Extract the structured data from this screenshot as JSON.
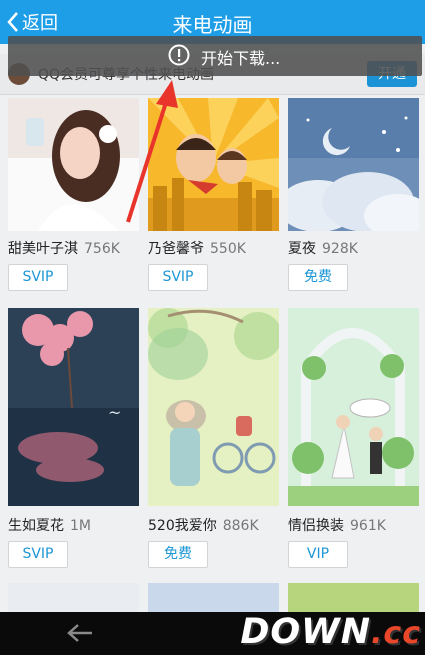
{
  "header": {
    "back_label": "返回",
    "title": "来电动画"
  },
  "banner": {
    "text": "QQ会员可尊享个性来电动画",
    "button": "开通"
  },
  "toast": {
    "message": "开始下载..."
  },
  "items": [
    {
      "name": "甜美叶子淇",
      "size": "756K",
      "badge": "SVIP"
    },
    {
      "name": "乃爸馨爷",
      "size": "550K",
      "badge": "SVIP"
    },
    {
      "name": "夏夜",
      "size": "928K",
      "badge": "免费"
    },
    {
      "name": "生如夏花",
      "size": "1M",
      "badge": "SVIP"
    },
    {
      "name": "520我爱你",
      "size": "886K",
      "badge": "免费"
    },
    {
      "name": "情侣换装",
      "size": "961K",
      "badge": "VIP"
    }
  ],
  "watermark": {
    "main": "DOWN",
    "suffix": ".cc"
  },
  "colors": {
    "header": "#1f9ee8",
    "accent": "#1c96d6",
    "annotation": "#e8342b"
  }
}
